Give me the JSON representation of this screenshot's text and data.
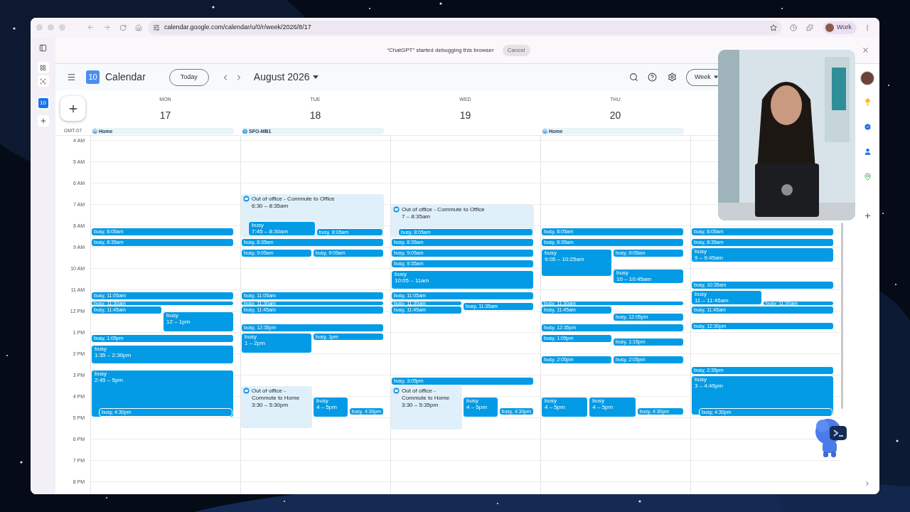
{
  "browser": {
    "url": "calendar.google.com/calendar/u/0/r/week/2026/8/17",
    "profile": "Work",
    "sidebar_badge": "10"
  },
  "debug_bar": {
    "message": "“ChatGPT” started debugging this browser",
    "cancel": "Cancel"
  },
  "header": {
    "logo": "10",
    "title": "Calendar",
    "today": "Today",
    "period": "August 2026",
    "view": "Week"
  },
  "timezone": "GMT-07",
  "hours": [
    "4 AM",
    "5 AM",
    "6 AM",
    "7 AM",
    "8 AM",
    "9 AM",
    "10 AM",
    "11 AM",
    "12 PM",
    "1 PM",
    "2 PM",
    "3 PM",
    "4 PM",
    "5 PM",
    "6 PM",
    "7 PM",
    "8 PM"
  ],
  "days": [
    {
      "weekday": "MON",
      "date": "17",
      "chip": {
        "kind": "home",
        "label": "Home"
      },
      "events": [
        {
          "kind": "short",
          "title": "busy, 8:05am"
        },
        {
          "kind": "short",
          "title": "busy, 8:35am"
        },
        {
          "kind": "short",
          "title": "busy, 11:05am"
        },
        {
          "kind": "short",
          "title": "busy, 11:30am"
        },
        {
          "kind": "overlap",
          "lanes": [
            [
              {
                "kind": "short",
                "title": "busy, 11:45am"
              }
            ],
            [
              {
                "kind": "block",
                "title": "busy",
                "time": "12 – 1pm"
              }
            ]
          ]
        },
        {
          "kind": "short",
          "title": "busy, 1:05pm"
        },
        {
          "kind": "block",
          "title": "busy",
          "time": "1:35 – 2:30pm"
        },
        {
          "kind": "block",
          "title": "busy",
          "time": "2:45 – 5pm",
          "children": [
            {
              "kind": "short",
              "title": "busy, 4:30pm"
            }
          ]
        }
      ]
    },
    {
      "weekday": "TUE",
      "date": "18",
      "chip": {
        "kind": "office",
        "label": "SFO-MB1"
      },
      "events": [
        {
          "kind": "ooo",
          "title": "Out of office - Commute to Office",
          "time": "6:30 – 8:35am",
          "children": [
            {
              "kind": "overlap",
              "lanes": [
                [
                  {
                    "kind": "block",
                    "title": "busy",
                    "time": "7:45 – 8:30am"
                  }
                ],
                [
                  {
                    "kind": "short",
                    "title": "busy, 8:05am"
                  }
                ]
              ]
            }
          ]
        },
        {
          "kind": "short",
          "title": "busy, 8:35am"
        },
        {
          "kind": "overlap",
          "lanes": [
            [
              {
                "kind": "short",
                "title": "busy, 9:05am"
              }
            ],
            [
              {
                "kind": "short",
                "title": "busy, 9:05am"
              }
            ]
          ]
        },
        {
          "kind": "short",
          "title": "busy, 11:05am"
        },
        {
          "kind": "short",
          "title": "busy, 11:30am"
        },
        {
          "kind": "short",
          "title": "busy, 11:45am"
        },
        {
          "kind": "short",
          "title": "busy, 12:35pm"
        },
        {
          "kind": "overlap",
          "lanes": [
            [
              {
                "kind": "block",
                "title": "busy",
                "time": "1 – 2pm"
              }
            ],
            [
              {
                "kind": "short",
                "title": "busy, 1pm"
              }
            ]
          ]
        },
        {
          "kind": "overlap",
          "lanes": [
            [
              {
                "kind": "ooo",
                "title": "Out of office - Commute to Home",
                "time": "3:30 – 5:30pm"
              }
            ],
            [
              {
                "kind": "block",
                "title": "busy",
                "time": "4 – 5pm"
              }
            ],
            [
              {
                "kind": "short",
                "title": "busy, 4:30pm"
              }
            ]
          ]
        }
      ]
    },
    {
      "weekday": "WED",
      "date": "19",
      "events": [
        {
          "kind": "ooo",
          "title": "Out of office - Commute to Office",
          "time": "7 – 8:35am",
          "children": [
            {
              "kind": "short",
              "title": "busy, 8:05am"
            }
          ]
        },
        {
          "kind": "short",
          "title": "busy, 8:35am"
        },
        {
          "kind": "short",
          "title": "busy, 9:05am"
        },
        {
          "kind": "short",
          "title": "busy, 9:35am"
        },
        {
          "kind": "block",
          "title": "busy",
          "time": "10:05 – 11am"
        },
        {
          "kind": "short",
          "title": "busy, 11:05am"
        },
        {
          "kind": "overlap",
          "lanes": [
            [
              {
                "kind": "short",
                "title": "busy, 11:30am"
              },
              {
                "kind": "short",
                "title": "busy, 11:45am"
              }
            ],
            [
              {
                "kind": "short",
                "title": "busy, 11:35am"
              }
            ]
          ]
        },
        {
          "kind": "short",
          "title": "busy, 3:05pm"
        },
        {
          "kind": "overlap",
          "lanes": [
            [
              {
                "kind": "ooo",
                "title": "Out of office - Commute to Home",
                "time": "3:30 – 5:35pm"
              }
            ],
            [
              {
                "kind": "block",
                "title": "busy",
                "time": "4 – 5pm"
              }
            ],
            [
              {
                "kind": "short",
                "title": "busy, 4:30pm"
              }
            ]
          ]
        }
      ]
    },
    {
      "weekday": "THU",
      "date": "20",
      "chip": {
        "kind": "home",
        "label": "Home"
      },
      "events": [
        {
          "kind": "short",
          "title": "busy, 8:05am"
        },
        {
          "kind": "short",
          "title": "busy, 8:35am"
        },
        {
          "kind": "overlap",
          "lanes": [
            [
              {
                "kind": "block",
                "title": "busy",
                "time": "9:05 – 10:25am"
              }
            ],
            [
              {
                "kind": "short",
                "title": "busy, 9:05am"
              },
              {
                "kind": "block",
                "title": "busy",
                "time": "10 – 10:45am"
              }
            ]
          ]
        },
        {
          "kind": "short",
          "title": "busy, 11:30am"
        },
        {
          "kind": "overlap",
          "lanes": [
            [
              {
                "kind": "short",
                "title": "busy, 11:45am"
              }
            ],
            [
              {
                "kind": "short",
                "title": "busy, 12:05pm"
              }
            ]
          ]
        },
        {
          "kind": "short",
          "title": "busy, 12:35pm"
        },
        {
          "kind": "overlap",
          "lanes": [
            [
              {
                "kind": "short",
                "title": "busy, 1:05pm"
              }
            ],
            [
              {
                "kind": "short",
                "title": "busy, 1:15pm"
              }
            ]
          ]
        },
        {
          "kind": "overlap",
          "lanes": [
            [
              {
                "kind": "short",
                "title": "busy, 2:05pm"
              }
            ],
            [
              {
                "kind": "short",
                "title": "busy, 2:05pm"
              }
            ]
          ]
        },
        {
          "kind": "overlap",
          "lanes": [
            [
              {
                "kind": "block",
                "title": "busy",
                "time": "4 – 5pm"
              }
            ],
            [
              {
                "kind": "block",
                "title": "busy",
                "time": "4 – 5pm"
              }
            ],
            [
              {
                "kind": "short",
                "title": "busy, 4:30pm"
              }
            ]
          ]
        }
      ]
    },
    {
      "events": [
        {
          "kind": "short",
          "title": "busy, 8:05am"
        },
        {
          "kind": "short",
          "title": "busy, 8:35am"
        },
        {
          "kind": "block",
          "title": "busy",
          "time": "9 – 9:45am"
        },
        {
          "kind": "short",
          "title": "busy, 10:35am"
        },
        {
          "kind": "overlap",
          "lanes": [
            [
              {
                "kind": "block",
                "title": "busy",
                "time": "11 – 11:45am"
              }
            ],
            [
              {
                "kind": "short",
                "title": "busy, 11:30am"
              }
            ]
          ]
        },
        {
          "kind": "short",
          "title": "busy, 11:45am"
        },
        {
          "kind": "short",
          "title": "busy, 12:30pm"
        },
        {
          "kind": "short",
          "title": "busy, 2:35pm"
        },
        {
          "kind": "block",
          "title": "busy",
          "time": "3 – 4:45pm",
          "children": [
            {
              "kind": "short",
              "title": "busy, 4:30pm"
            }
          ]
        }
      ]
    }
  ]
}
